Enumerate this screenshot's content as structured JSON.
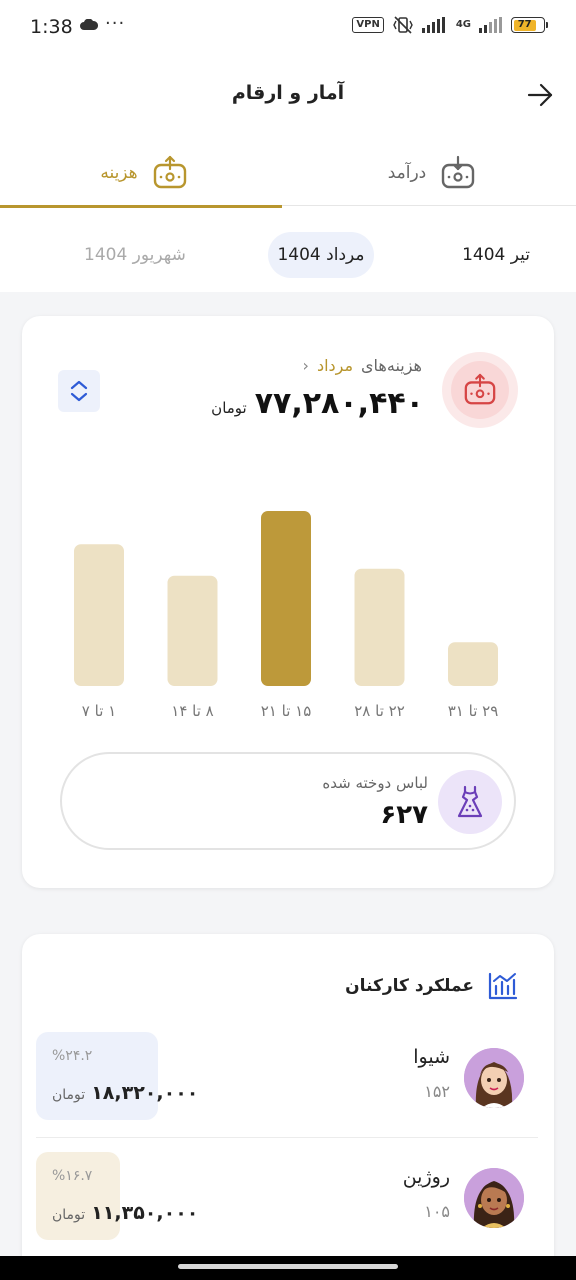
{
  "status_bar": {
    "time": "1:38",
    "dots": "···",
    "vpn": "VPN",
    "network": "4G",
    "battery": "77"
  },
  "header": {
    "title": "آمار و ارقام"
  },
  "tabs": [
    {
      "label": "هزینه",
      "active": true
    },
    {
      "label": "درآمد",
      "active": false
    }
  ],
  "months": {
    "tir": "تیر 1404",
    "mordad": "مرداد 1404",
    "shahrivar": "شهریور 1404",
    "selected": "mordad"
  },
  "expense_card": {
    "label": "هزینه‌های",
    "month": "مرداد",
    "amount": "۷۷,۲۸۰,۴۴۰",
    "currency": "تومان"
  },
  "chart_data": {
    "type": "bar",
    "categories": [
      "۱ تا ۷",
      "۸ تا ۱۴",
      "۱۵ تا ۲۱",
      "۲۲ تا ۲۸",
      "۲۹ تا ۳۱"
    ],
    "values": [
      0.81,
      0.63,
      1.0,
      0.67,
      0.25
    ],
    "highlighted_index": 2,
    "colors": {
      "normal": "#ede1c4",
      "highlight": "#bd993a"
    }
  },
  "dress_stat": {
    "label": "لباس دوخته شده",
    "count": "۶۲۷"
  },
  "performance": {
    "title": "عملکرد کارکنان",
    "employees": [
      {
        "name": "شیوا",
        "count": "۱۵۲",
        "percent": "%۲۴.۲",
        "amount": "۱۸,۳۲۰,۰۰۰",
        "currency": "تومان"
      },
      {
        "name": "روژین",
        "count": "۱۰۵",
        "percent": "%۱۶.۷",
        "amount": "۱۱,۳۵۰,۰۰۰",
        "currency": "تومان"
      }
    ]
  },
  "colors": {
    "accent_gold": "#b8962e",
    "expense_red": "#d64545",
    "income_gray": "#666666",
    "blue": "#2e5bd6",
    "purple": "#6b3fb8"
  }
}
